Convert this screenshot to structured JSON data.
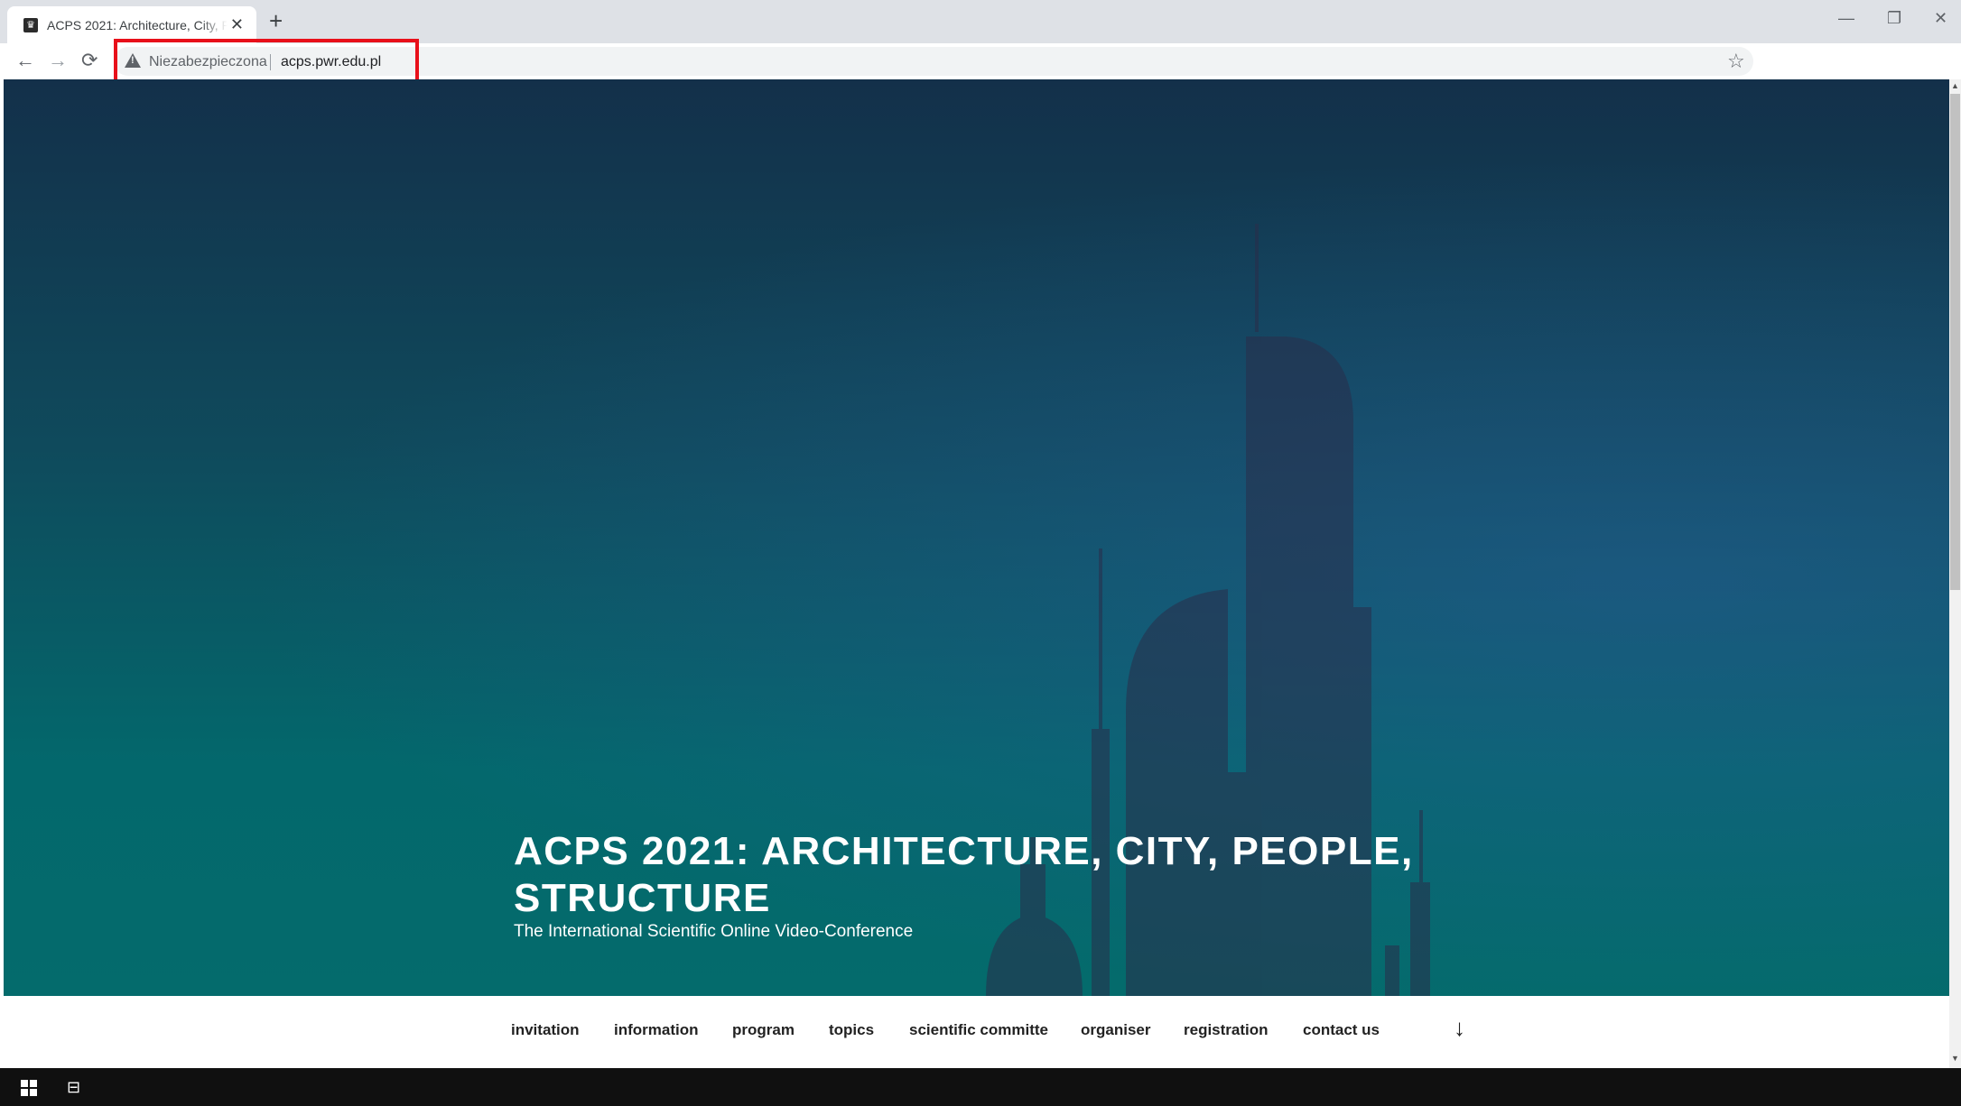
{
  "browser": {
    "tab_title": "ACPS 2021: Architecture, City, Pe",
    "favicon_glyph": "♛",
    "close_glyph": "✕",
    "new_tab_glyph": "+",
    "window_controls": {
      "minimize": "—",
      "restore": "❐",
      "close": "✕"
    },
    "nav": {
      "back": "←",
      "forward": "→",
      "reload": "⟳"
    },
    "security_label": "Niezabezpieczona",
    "url": "acps.pwr.edu.pl",
    "bookmark_glyph": "☆"
  },
  "page": {
    "title": "ACPS 2021: ARCHITECTURE, CITY, PEOPLE, STRUCTURE",
    "subtitle": "The International Scientific Online Video-Conference",
    "menu": [
      "invitation",
      "information",
      "program",
      "topics",
      "scientific committe",
      "organiser",
      "registration",
      "contact us"
    ],
    "scroll_down_glyph": "↓"
  },
  "taskbar": {
    "taskview_glyph": "⊟"
  },
  "colors": {
    "highlight": "#e8101a",
    "hero_top": "#13304a",
    "hero_bottom": "#046b6c"
  }
}
